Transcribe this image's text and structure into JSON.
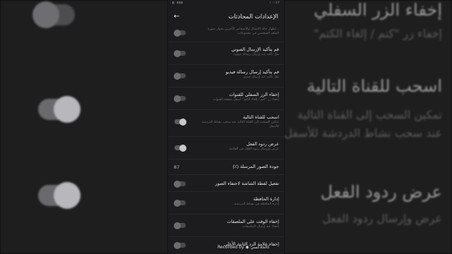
{
  "status_bar": {
    "time": "١٠:٤٢",
    "right": "◧ ▮▮▮"
  },
  "header": {
    "title": "الإعدادات المحادثات"
  },
  "rows": [
    {
      "label": "",
      "sub": "...إظهار حالة الاتصال والأشخاص الآخرين بجوار صورة الملف الشخصي في مجموعات",
      "toggle": false
    },
    {
      "label": "قم بتأكيد الإرسال الصوتي",
      "sub": "نقل تأكيد عند إرسال رسالة صوتية",
      "toggle": false
    },
    {
      "label": "قم بتأكيد إرسال رسالة فيديو",
      "sub": "نقل تأكيد عند إرسال فيديو",
      "toggle": false
    },
    {
      "label": "إخفاء الزر السفلي للقنوات",
      "sub": "إخفاء زر \"كتم / إلغاء الكتم\" أسفل صفحة القنوات",
      "toggle": false
    },
    {
      "label": "اسحب للقناة التالية",
      "sub": "تمكين السحب إلى القناة التالية عند سحب نشاط الدردشة للأسفل",
      "toggle": true
    },
    {
      "label": "عرض ردود الفعل",
      "sub": "عرض وإرسال ردود الفعل في القائمة",
      "toggle": true
    },
    {
      "label": "جودة الصور المرسلة (٪)",
      "value": "87"
    },
    {
      "label": "تفعيل لقطة الشاشة لاختفاء الصور",
      "toggle": false
    },
    {
      "label": "إدارة الحافظة",
      "sub": "إدارة الحافظة في نشاط الدردشة",
      "toggle": false
    },
    {
      "label": "إخفاء الوقت على الملصقات",
      "sub": "إخفاء عند إرسال الملصقات",
      "toggle": false
    },
    {
      "label": "إخفاء علامة الرد الثابتة الأعلى",
      "toggle": false
    }
  ],
  "background": {
    "left": [
      {
        "title": "إخفاء الزر السفلي",
        "sub": "إخفاء زر \"كتم / إلغاء الكتم\"",
        "toggle": false
      },
      {
        "title": "اسحب للقناة التالية",
        "sub": "تمكين السحب إلى القناة التالية عند سحب نشاط الدردشة للأسفل",
        "toggle": true
      },
      {
        "title": "عرض ردود الفعل",
        "sub": "عرض وإرسال ردود الفعل",
        "toggle": true
      }
    ]
  },
  "watermark": "Recorded by ◉ كالجلاكسي"
}
